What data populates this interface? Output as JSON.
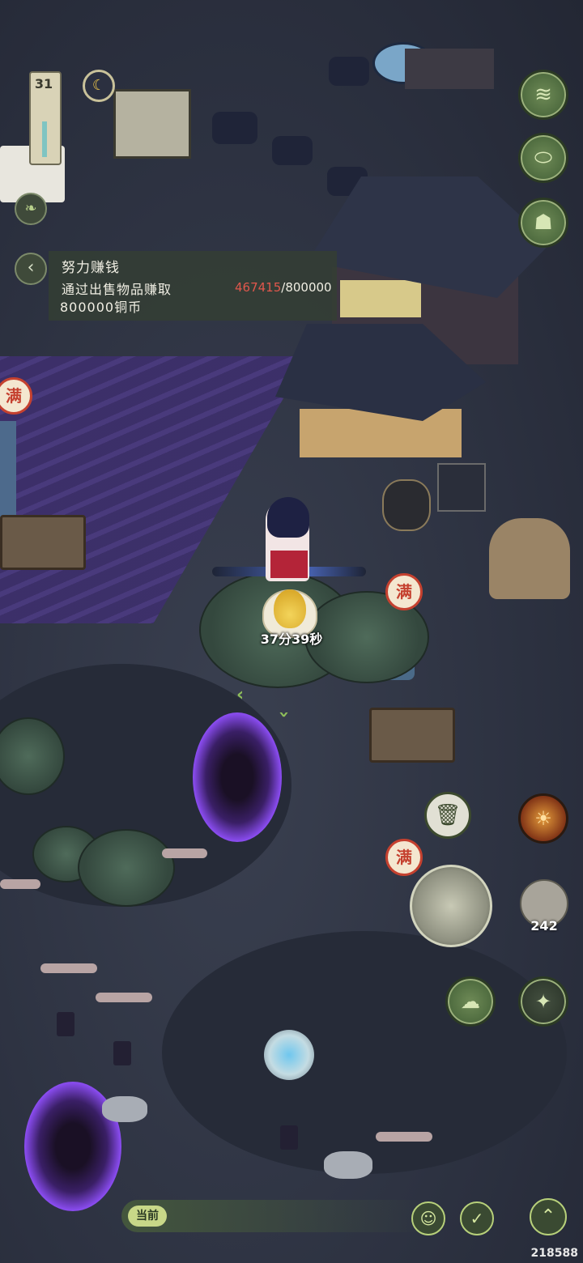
{
  "hud": {
    "level": "31",
    "coords": "218588"
  },
  "quest": {
    "title": "努力赚钱",
    "description_line1": "通过出售物品赚取",
    "description_line2": "800000铜币",
    "progress_current": "467415",
    "progress_total": "/800000",
    "back_icon": "chevron-left-icon"
  },
  "status_badges": {
    "full_label": "满"
  },
  "crop": {
    "timer": "37分39秒",
    "icon": "pear-icon"
  },
  "inventory": {
    "scroll_count": "242"
  },
  "chat": {
    "channel_label": "当前"
  },
  "right_menu": [
    {
      "name": "water-wave-icon",
      "glyph": "≋"
    },
    {
      "name": "pot-icon",
      "glyph": "⬭"
    },
    {
      "name": "demon-mask-icon",
      "glyph": "☗"
    }
  ],
  "colors": {
    "accent_green": "#6e8a56",
    "progress_red": "#e0574c",
    "badge_red": "#c5412f",
    "portal_purple": "#8a4cf0"
  }
}
